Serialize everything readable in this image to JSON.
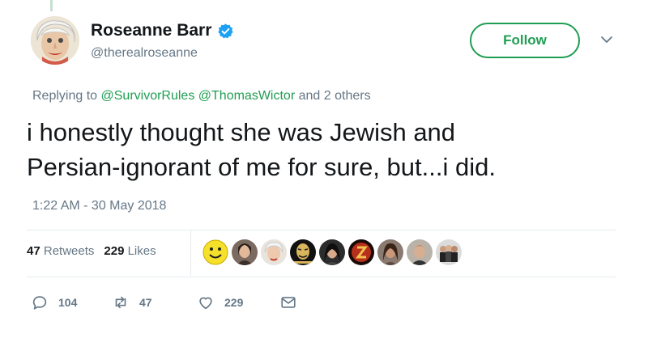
{
  "author": {
    "display_name": "Roseanne Barr",
    "handle": "@therealroseanne",
    "verified": true
  },
  "follow_button": {
    "label": "Follow"
  },
  "reply": {
    "prefix": "Replying to",
    "mentions": [
      "@SurvivorRules",
      "@ThomasWictor"
    ],
    "suffix": "and 2 others"
  },
  "tweet": {
    "lines": [
      "i honestly thought she was Jewish and",
      "Persian-ignorant of me for sure, but...i did."
    ],
    "timestamp": "1:22 AM - 30 May 2018"
  },
  "stats": {
    "retweets_count": "47",
    "retweets_label": "Retweets",
    "likes_count": "229",
    "likes_label": "Likes"
  },
  "likers": [
    {
      "icon": "smiley-face-avatar"
    },
    {
      "icon": "woman-avatar"
    },
    {
      "icon": "elderly-woman-avatar"
    },
    {
      "icon": "masked-face-avatar"
    },
    {
      "icon": "woman-portrait-avatar"
    },
    {
      "icon": "red-logo-avatar"
    },
    {
      "icon": "dark-hair-avatar"
    },
    {
      "icon": "man-portrait-avatar"
    },
    {
      "icon": "group-avatar"
    }
  ],
  "actions": {
    "reply_count": "104",
    "retweet_count": "47",
    "like_count": "229"
  },
  "colors": {
    "accent": "#1f9e52",
    "verified": "#1da1f2",
    "muted": "#657786",
    "text": "#14171a"
  }
}
